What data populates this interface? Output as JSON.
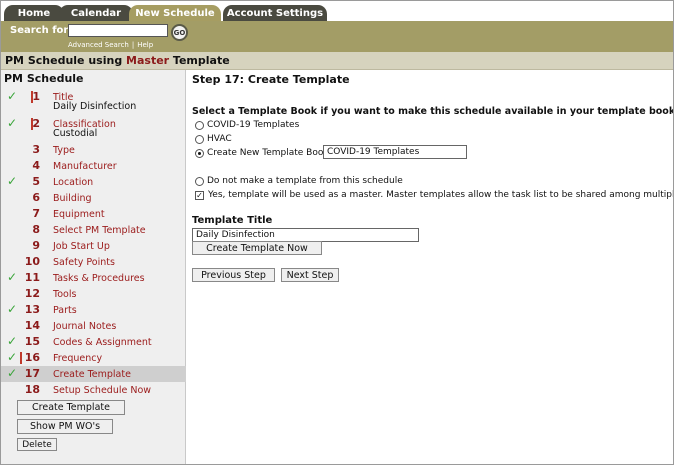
{
  "tabs": [
    {
      "label": "Home",
      "active": false
    },
    {
      "label": "Calendar",
      "active": false
    },
    {
      "label": "New Schedule",
      "active": true
    },
    {
      "label": "Account Settings",
      "active": false
    }
  ],
  "search": {
    "label": "Search for:",
    "value": "",
    "go_label": "GO",
    "advanced_link": "Advanced Search",
    "help_link": "Help"
  },
  "header": {
    "title_prefix": "PM Schedule using ",
    "title_accent": "Master",
    "title_suffix": " Template"
  },
  "sidebar": {
    "heading": "PM Schedule",
    "steps": [
      {
        "num": "1",
        "label": "Title",
        "sub": "Daily Disinfection",
        "checked": true
      },
      {
        "num": "2",
        "label": "Classification",
        "sub": "Custodial",
        "checked": true
      },
      {
        "num": "3",
        "label": "Type",
        "checked": false
      },
      {
        "num": "4",
        "label": "Manufacturer",
        "checked": false
      },
      {
        "num": "5",
        "label": "Location",
        "checked": true
      },
      {
        "num": "6",
        "label": "Building",
        "checked": false
      },
      {
        "num": "7",
        "label": "Equipment",
        "checked": false
      },
      {
        "num": "8",
        "label": "Select PM Template",
        "checked": false
      },
      {
        "num": "9",
        "label": "Job Start Up",
        "checked": false
      },
      {
        "num": "10",
        "label": "Safety Points",
        "checked": false
      },
      {
        "num": "11",
        "label": "Tasks & Procedures",
        "checked": true
      },
      {
        "num": "12",
        "label": "Tools",
        "checked": false
      },
      {
        "num": "13",
        "label": "Parts",
        "checked": true
      },
      {
        "num": "14",
        "label": "Journal Notes",
        "checked": false
      },
      {
        "num": "15",
        "label": "Codes & Assignment",
        "checked": true
      },
      {
        "num": "16",
        "label": "Frequency",
        "checked": true
      },
      {
        "num": "17",
        "label": "Create Template",
        "checked": true,
        "active": true
      },
      {
        "num": "18",
        "label": "Setup Schedule Now",
        "checked": false
      }
    ],
    "create_template_button": "Create Template",
    "show_pm_wos_button": "Show PM WO's",
    "delete_button": "Delete"
  },
  "main": {
    "step_title": "Step 17: Create Template",
    "section_heading": "Select a Template Book if you want to make this schedule available in your template book.",
    "options": [
      {
        "label": "COVID-19 Templates",
        "selected": false
      },
      {
        "label": "HVAC",
        "selected": false
      },
      {
        "label": "Create New Template Book",
        "selected": true
      }
    ],
    "new_book_value": "COVID-19 Templates",
    "no_template_label": "Do not make a template from this schedule",
    "master_checkbox_label": "Yes, template will be used as a master. Master templates allow the task list to be shared among multiple schedules.",
    "master_checked": true,
    "template_title_label": "Template Title",
    "template_title_value": "Daily Disinfection",
    "create_now_button": "Create Template Now",
    "previous_button": "Previous Step",
    "next_button": "Next Step"
  },
  "colors": {
    "olive": "#a39d66",
    "tab_dark": "#4a4a40",
    "accent_red": "#8b1a1a",
    "check_green": "#3aa53a"
  }
}
